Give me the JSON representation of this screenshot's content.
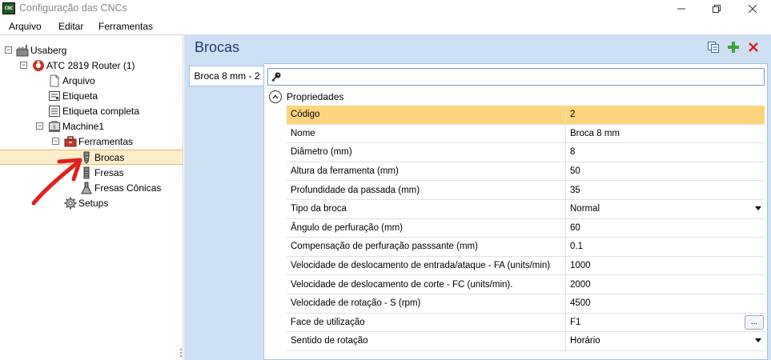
{
  "window": {
    "title": "Configuração das CNCs",
    "icon_text": "CNC",
    "controls": [
      "minimize-icon",
      "maximize-icon",
      "close-icon"
    ]
  },
  "menu": [
    "Arquivo",
    "Editar",
    "Ferramentas"
  ],
  "tree": {
    "root": "Usaberg",
    "router": "ATC 2819 Router (1)",
    "arquivo": "Arquivo",
    "etiqueta": "Etiqueta",
    "etiqueta_completa": "Etiqueta completa",
    "machine": "Machine1",
    "ferramentas": "Ferramentas",
    "brocas": "Brocas",
    "fresas": "Fresas",
    "fresas_conicas": "Fresas Cônicas",
    "setups": "Setups"
  },
  "panel": {
    "title": "Brocas",
    "tab": "Broca 8 mm - 2",
    "group": "Propriedades",
    "actions": [
      "copy-icon",
      "add-icon",
      "delete-icon"
    ],
    "accent": "#1e3b6b"
  },
  "properties": [
    {
      "name": "Código",
      "value": "2"
    },
    {
      "name": "Nome",
      "value": "Broca 8 mm"
    },
    {
      "name": "Diâmetro (mm)",
      "value": "8"
    },
    {
      "name": "Altura da ferramenta (mm)",
      "value": "50"
    },
    {
      "name": "Profundidade da passada (mm)",
      "value": "35"
    },
    {
      "name": "Tipo da broca",
      "value": "Normal"
    },
    {
      "name": "Ângulo de perfuração (mm)",
      "value": "60"
    },
    {
      "name": "Compensação de perfuração passsante (mm)",
      "value": "0.1"
    },
    {
      "name": "Velocidade de deslocamento de entrada/ataque - FA (units/min)",
      "value": "1000"
    },
    {
      "name": "Velocidade de deslocamento de corte - FC (units/min).",
      "value": "2000"
    },
    {
      "name": "Velocidade de rotação - S (rpm)",
      "value": "4500"
    },
    {
      "name": "Face de utilização",
      "value": "F1"
    },
    {
      "name": "Sentido de rotação",
      "value": "Horário"
    }
  ],
  "ellipsis_label": "..."
}
